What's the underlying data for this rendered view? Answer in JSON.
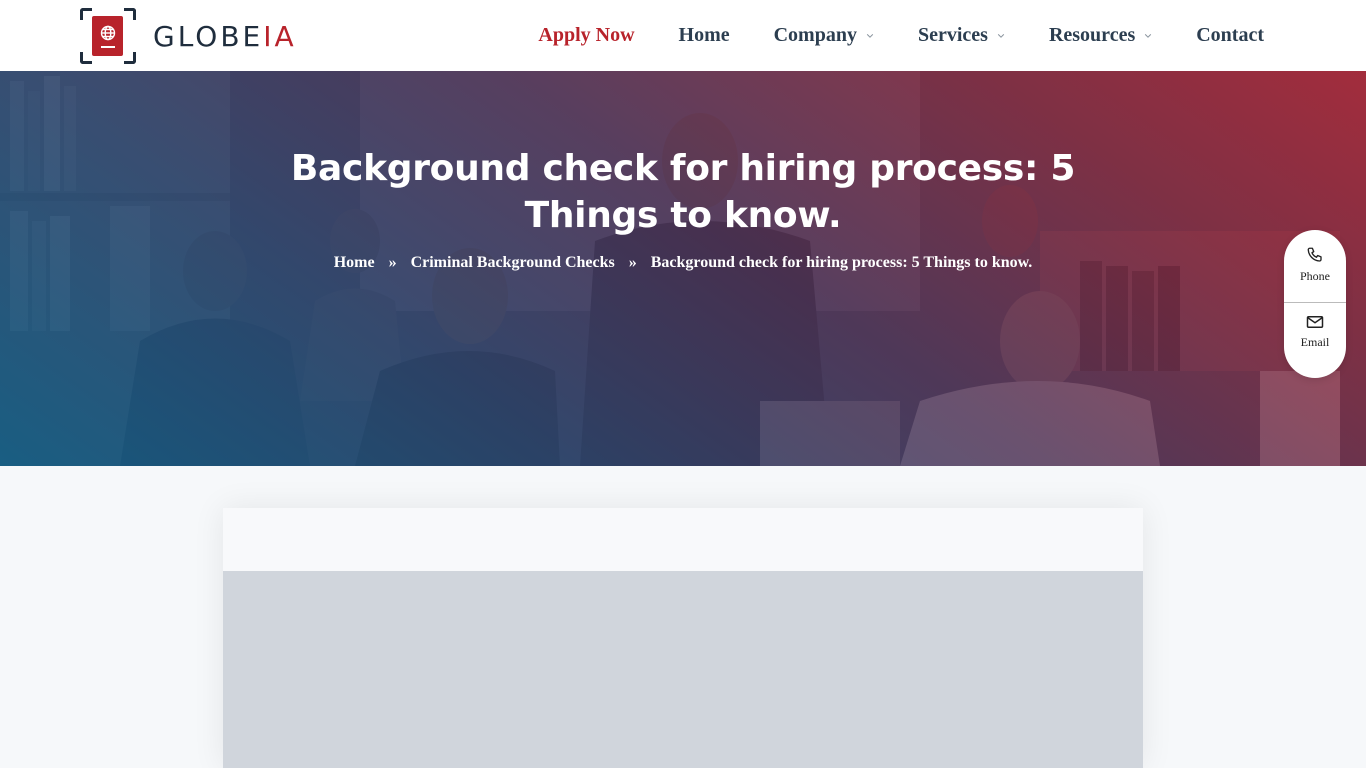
{
  "brand": {
    "name_main": "GLOBE",
    "name_accent": "IA",
    "accent_color": "#b8232b",
    "text_color": "#1f2d3d",
    "logo_icon": "passport-globe-icon"
  },
  "nav": {
    "items": [
      {
        "label": "Apply Now",
        "highlight": true,
        "has_dropdown": false
      },
      {
        "label": "Home",
        "has_dropdown": false
      },
      {
        "label": "Company",
        "has_dropdown": true
      },
      {
        "label": "Services",
        "has_dropdown": true
      },
      {
        "label": "Resources",
        "has_dropdown": true
      },
      {
        "label": "Contact",
        "has_dropdown": false
      }
    ]
  },
  "hero": {
    "title": "Background check for hiring process: 5 Things to know.",
    "breadcrumb": [
      {
        "label": "Home"
      },
      {
        "label": "Criminal Background Checks"
      },
      {
        "label": "Background check for hiring process: 5 Things to know."
      }
    ],
    "separator": "»",
    "gradient_colors": [
      "#125c82",
      "#b02837"
    ]
  },
  "float_contact": {
    "items": [
      {
        "label": "Phone",
        "icon": "phone-icon"
      },
      {
        "label": "Email",
        "icon": "envelope-icon"
      }
    ]
  },
  "content": {
    "card_bg": "#f8f9fb",
    "media_placeholder_bg": "#d0d5dc"
  }
}
